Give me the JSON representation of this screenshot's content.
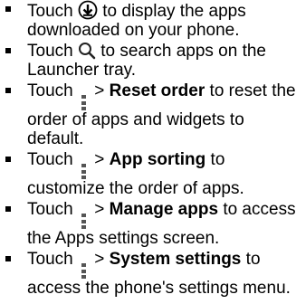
{
  "items": [
    {
      "pre": "Touch",
      "icon": "download-circle-icon",
      "post": "to display the apps downloaded on your phone."
    },
    {
      "pre": "Touch",
      "icon": "search-icon",
      "post": "to search apps on the Launcher tray."
    },
    {
      "pre": "Touch",
      "icon": "menu-dots-icon",
      "mid": ">",
      "bold": "Reset order",
      "post": "to reset the order of apps and widgets to default."
    },
    {
      "pre": "Touch",
      "icon": "menu-dots-icon",
      "mid": ">",
      "bold": "App sorting",
      "post": "to customize the order of apps."
    },
    {
      "pre": "Touch",
      "icon": "menu-dots-icon",
      "mid": ">",
      "bold": "Manage apps",
      "post": "to access the Apps settings screen."
    },
    {
      "pre": "Touch",
      "icon": "menu-dots-icon",
      "mid": ">",
      "bold": "System settings",
      "post": "to access the phone's settings menu."
    }
  ]
}
